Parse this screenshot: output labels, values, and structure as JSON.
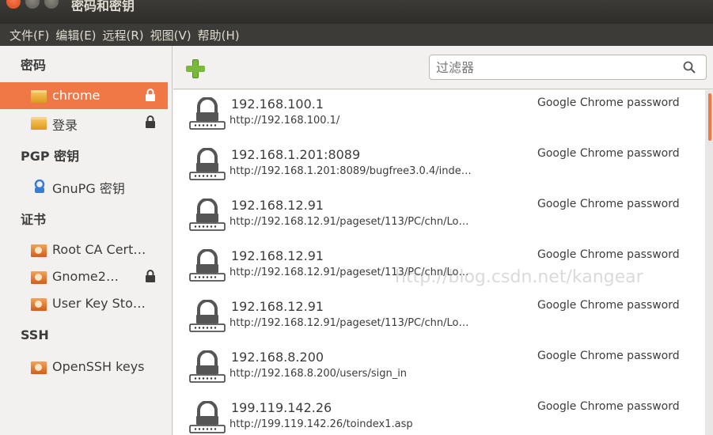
{
  "window": {
    "title": "密码和密钥"
  },
  "menubar": [
    "文件(F)",
    "编辑(E)",
    "远程(R)",
    "视图(V)",
    "帮助(H)"
  ],
  "sidebar": {
    "sections": [
      {
        "title": "密码",
        "items": [
          {
            "label": "chrome",
            "icon": "folder-icon",
            "locked": true,
            "selected": true
          },
          {
            "label": "登录",
            "icon": "folder-icon",
            "locked": true
          }
        ]
      },
      {
        "title": "PGP 密钥",
        "items": [
          {
            "label": "GnuPG 密钥",
            "icon": "key-person-icon"
          }
        ]
      },
      {
        "title": "证书",
        "items": [
          {
            "label": "Root CA Cert…",
            "icon": "certificate-icon"
          },
          {
            "label": "Gnome2…",
            "icon": "certificate-icon",
            "locked": true
          },
          {
            "label": "User Key Sto…",
            "icon": "certificate-icon"
          }
        ]
      },
      {
        "title": "SSH",
        "items": [
          {
            "label": "OpenSSH keys",
            "icon": "certificate-icon"
          }
        ]
      }
    ]
  },
  "toolbar": {
    "add_icon": "plus-icon",
    "filter_placeholder": "过滤器",
    "search_icon": "search-icon"
  },
  "entries": [
    {
      "name": "192.168.100.1",
      "url": "http://192.168.100.1/",
      "type": "Google Chrome password"
    },
    {
      "name": "192.168.1.201:8089",
      "url": "http://192.168.1.201:8089/bugfree3.0.4/inde…",
      "type": "Google Chrome password"
    },
    {
      "name": "192.168.12.91",
      "url": "http://192.168.12.91/pageset/113/PC/chn/Lo…",
      "type": "Google Chrome password"
    },
    {
      "name": "192.168.12.91",
      "url": "http://192.168.12.91/pageset/113/PC/chn/Lo…",
      "type": "Google Chrome password"
    },
    {
      "name": "192.168.12.91",
      "url": "http://192.168.12.91/pageset/113/PC/chn/Lo…",
      "type": "Google Chrome password"
    },
    {
      "name": "192.168.8.200",
      "url": "http://192.168.8.200/users/sign_in",
      "type": "Google Chrome password"
    },
    {
      "name": "199.119.142.26",
      "url": "http://199.119.142.26/toindex1.asp",
      "type": "Google Chrome password"
    }
  ],
  "watermark": "http://blog.csdn.net/kangear",
  "colors": {
    "accent": "#f07746",
    "titlebar": "#3c3b37"
  }
}
